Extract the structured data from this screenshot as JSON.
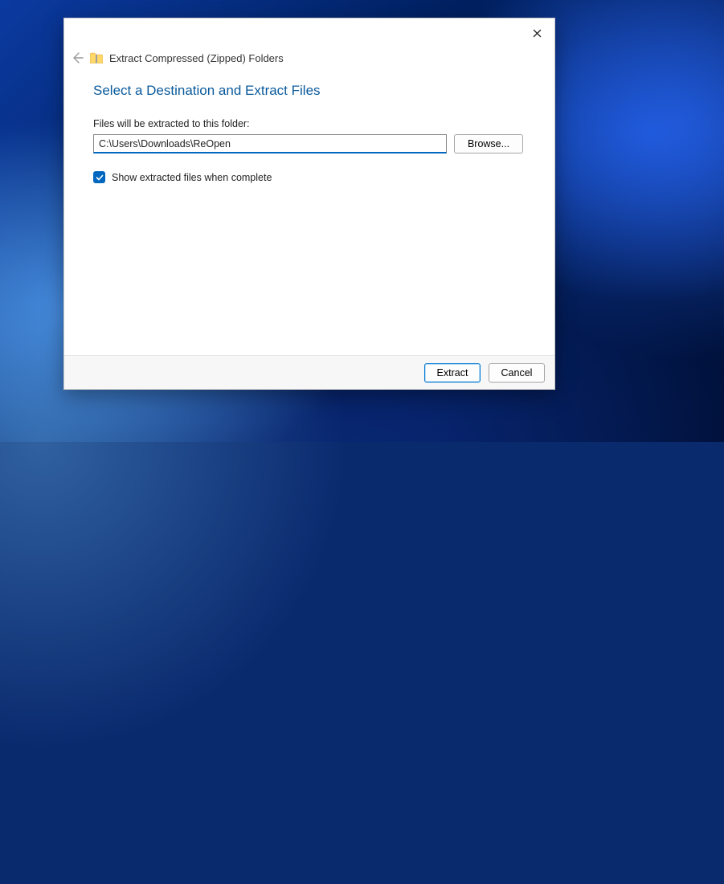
{
  "window": {
    "title": "Extract Compressed (Zipped) Folders"
  },
  "instruction": "Select a Destination and Extract Files",
  "field": {
    "label": "Files will be extracted to this folder:",
    "value": "C:\\Users\\Downloads\\ReOpen"
  },
  "buttons": {
    "browse": "Browse...",
    "extract": "Extract",
    "cancel": "Cancel"
  },
  "checkbox": {
    "label": "Show extracted files when complete",
    "checked": true
  }
}
